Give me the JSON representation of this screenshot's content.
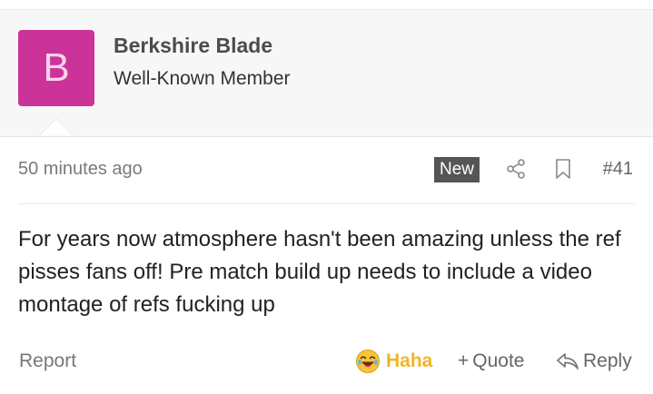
{
  "user": {
    "avatar_letter": "B",
    "avatar_color": "#cc3399",
    "username": "Berkshire Blade",
    "title": "Well-Known Member"
  },
  "meta": {
    "timestamp": "50 minutes ago",
    "new_badge": "New",
    "post_number": "#41",
    "share_icon": "share-icon",
    "bookmark_icon": "bookmark-icon"
  },
  "message": {
    "text": "For years now atmosphere hasn't been amazing unless the ref pisses fans off! Pre match build up needs to include a video montage of refs fucking up"
  },
  "footer": {
    "report_label": "Report",
    "reaction_label": "Haha",
    "reaction_icon": "laughing-face-icon",
    "reaction_color": "#f0b429",
    "quote_prefix": "+",
    "quote_label": "Quote",
    "reply_label": "Reply",
    "reply_icon": "reply-arrow-icon"
  }
}
